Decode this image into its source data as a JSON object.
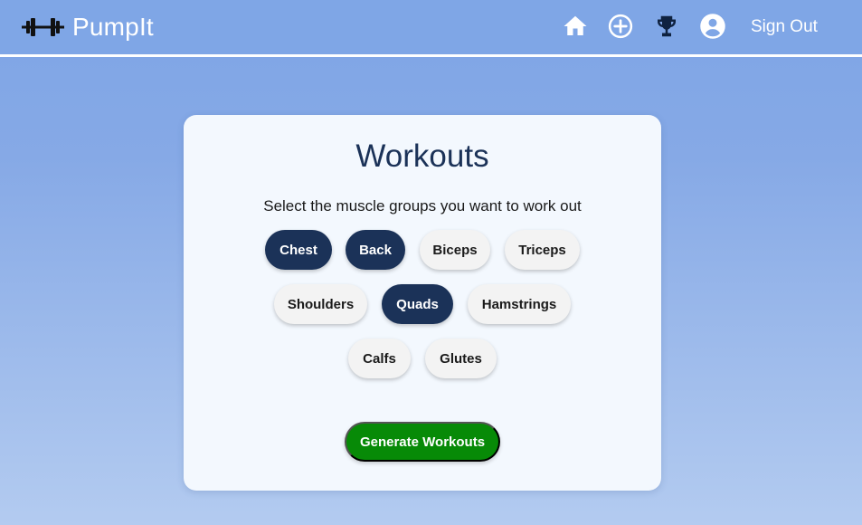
{
  "nav": {
    "brand": "PumpIt",
    "icons": [
      "barbell-icon",
      "home-icon",
      "add-circle-icon",
      "trophy-icon",
      "account-circle-icon"
    ],
    "signout_label": "Sign Out"
  },
  "workouts": {
    "title": "Workouts",
    "subtitle": "Select the muscle groups you want to work out",
    "muscle_groups": [
      {
        "label": "Chest",
        "selected": true
      },
      {
        "label": "Back",
        "selected": true
      },
      {
        "label": "Biceps",
        "selected": false
      },
      {
        "label": "Triceps",
        "selected": false
      },
      {
        "label": "Shoulders",
        "selected": false
      },
      {
        "label": "Quads",
        "selected": true
      },
      {
        "label": "Hamstrings",
        "selected": false
      },
      {
        "label": "Calfs",
        "selected": false
      },
      {
        "label": "Glutes",
        "selected": false
      }
    ],
    "generate_label": "Generate Workouts"
  },
  "colors": {
    "navbar": "#7fa6e6",
    "selected_chip": "#1b3258",
    "unselected_chip": "#f3f3f3",
    "generate_button": "#078a07",
    "card": "#f3f8fe"
  }
}
